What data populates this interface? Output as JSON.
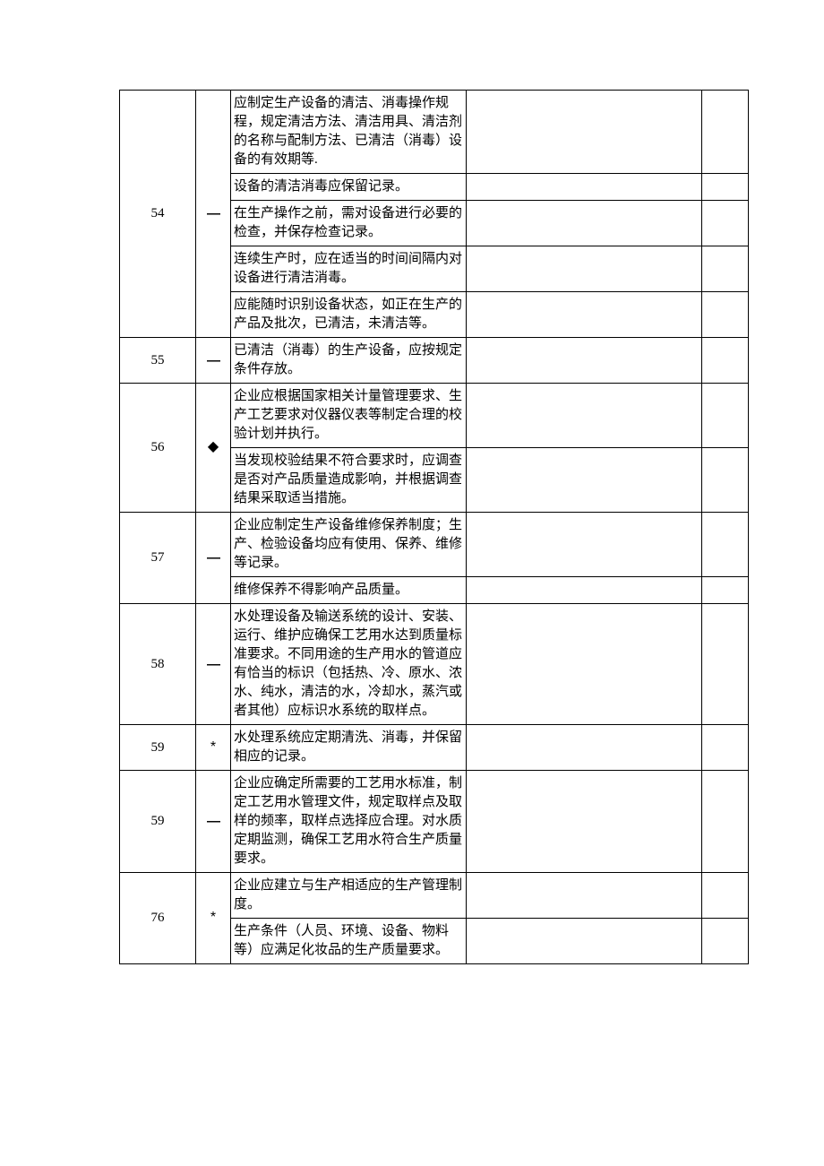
{
  "rows": [
    {
      "num": "54",
      "mark": "—",
      "markClass": "dash",
      "items": [
        "应制定生产设备的清洁、消毒操作规程，规定清洁方法、清洁用具、清洁剂的名称与配制方法、已清洁（消毒）设备的有效期等.",
        "设备的清洁消毒应保留记录。",
        "在生产操作之前，需对设备进行必要的检查，并保存检查记录。",
        "连续生产时，应在适当的时间间隔内对设备进行清洁消毒。",
        "应能随时识别设备状态，如正在生产的产品及批次，已清洁，未清洁等。"
      ]
    },
    {
      "num": "55",
      "mark": "—",
      "markClass": "dash",
      "items": [
        "已清洁（消毒）的生产设备，应按规定条件存放。"
      ]
    },
    {
      "num": "56",
      "mark": "◆",
      "markClass": "diamond",
      "items": [
        "企业应根据国家相关计量管理要求、生产工艺要求对仪器仪表等制定合理的校验计划并执行。",
        "当发现校验结果不符合要求时，应调查是否对产品质量造成影响，并根据调查结果采取适当措施。"
      ]
    },
    {
      "num": "57",
      "mark": "—",
      "markClass": "dash",
      "items": [
        "企业应制定生产设备维修保养制度；生产、检验设备均应有使用、保养、维修等记录。",
        "维修保养不得影响产品质量。"
      ]
    },
    {
      "num": "58",
      "mark": "—",
      "markClass": "dash",
      "items": [
        "水处理设备及输送系统的设计、安装、运行、维护应确保工艺用水达到质量标准要求。不同用途的生产用水的管道应有恰当的标识（包括热、冷、原水、浓水、纯水，清洁的水，冷却水，蒸汽或者其他）应标识水系统的取样点。"
      ]
    },
    {
      "num": "59",
      "mark": "*",
      "markClass": "star",
      "items": [
        "水处理系统应定期清洗、消毒，并保留相应的记录。"
      ]
    },
    {
      "num": "59",
      "mark": "—",
      "markClass": "dash",
      "items": [
        "企业应确定所需要的工艺用水标准，制定工艺用水管理文件，规定取样点及取样的频率，取样点选择应合理。对水质定期监测，确保工艺用水符合生产质量要求。"
      ]
    },
    {
      "num": "76",
      "mark": "*",
      "markClass": "star",
      "items": [
        "企业应建立与生产相适应的生产管理制度。",
        "生产条件（人员、环境、设备、物料等）应满足化妆品的生产质量要求。"
      ]
    }
  ]
}
